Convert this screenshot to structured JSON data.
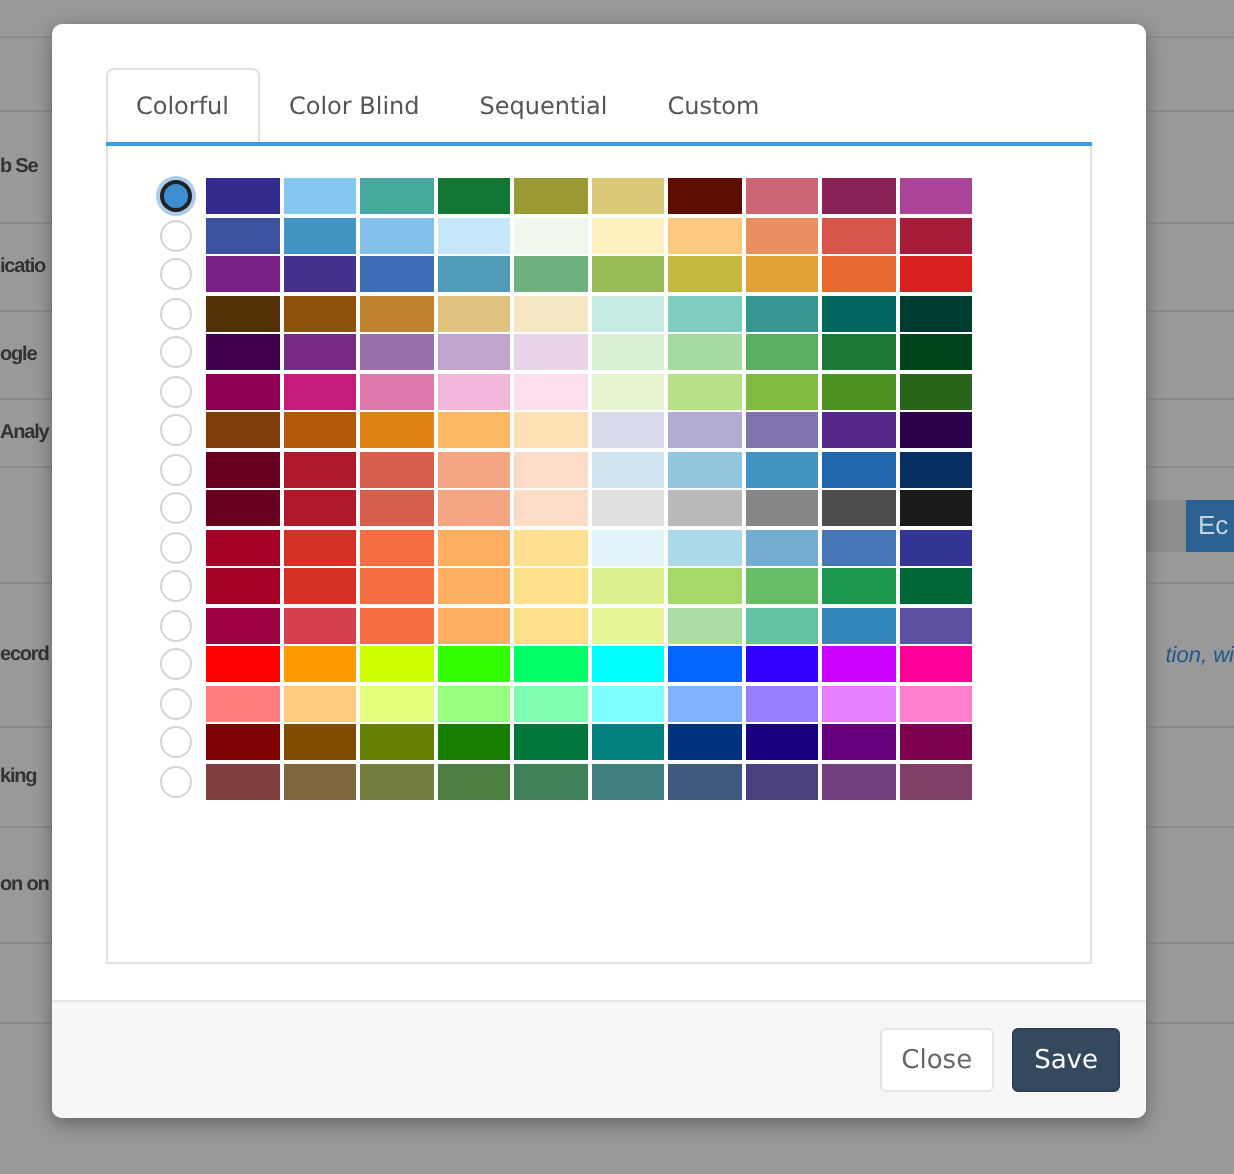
{
  "background_page": {
    "labels": [
      {
        "text": "b Se"
      },
      {
        "text": "icatio"
      },
      {
        "text": "ogle"
      },
      {
        "text": "Analy"
      },
      {
        "text": "ecord"
      },
      {
        "text": "king"
      },
      {
        "text": "on on"
      }
    ],
    "edit_button": "Ec",
    "note": "tion, wi"
  },
  "dialog": {
    "tabs": [
      {
        "label": "Colorful",
        "selected": true
      },
      {
        "label": "Color Blind",
        "selected": false
      },
      {
        "label": "Sequential",
        "selected": false
      },
      {
        "label": "Custom",
        "selected": false
      }
    ],
    "palettes": [
      {
        "selected": true,
        "swatches": [
          {
            "color": "#322a8c"
          },
          {
            "color": "#85c8ef"
          },
          {
            "color": "#45a99b"
          },
          {
            "color": "#127735"
          },
          {
            "color": "#9a9a35"
          },
          {
            "color": "#dbc97a"
          },
          {
            "color": "#5f0f00"
          },
          {
            "color": "#cc6677"
          },
          {
            "color": "#882255"
          },
          {
            "color": "#aa4499"
          }
        ]
      },
      {
        "selected": false,
        "swatches": [
          {
            "color": "#3e53a0"
          },
          {
            "color": "#4393c3"
          },
          {
            "color": "#86c1ec"
          },
          {
            "color": "#c8e6f9"
          },
          {
            "color": "#f0f7ed"
          },
          {
            "color": "#fdf0bd"
          },
          {
            "color": "#fdc980"
          },
          {
            "color": "#ea9060"
          },
          {
            "color": "#d6574a"
          },
          {
            "color": "#a61c3a"
          }
        ]
      },
      {
        "selected": false,
        "swatches": [
          {
            "color": "#7a1f86"
          },
          {
            "color": "#45318c"
          },
          {
            "color": "#3f6db5"
          },
          {
            "color": "#509bb7"
          },
          {
            "color": "#6fb27f"
          },
          {
            "color": "#9bbb59"
          },
          {
            "color": "#c5b840"
          },
          {
            "color": "#e1a236"
          },
          {
            "color": "#e86930"
          },
          {
            "color": "#da2121"
          }
        ]
      },
      {
        "selected": false,
        "swatches": [
          {
            "color": "#543005"
          },
          {
            "color": "#8c510a"
          },
          {
            "color": "#bf812d"
          },
          {
            "color": "#dfc27d"
          },
          {
            "color": "#f6e8c3"
          },
          {
            "color": "#c7eae5"
          },
          {
            "color": "#80cdc1"
          },
          {
            "color": "#35978f"
          },
          {
            "color": "#01665e"
          },
          {
            "color": "#003c30"
          }
        ]
      },
      {
        "selected": false,
        "swatches": [
          {
            "color": "#40004b"
          },
          {
            "color": "#762a83"
          },
          {
            "color": "#9970ab"
          },
          {
            "color": "#c2a5cf"
          },
          {
            "color": "#e7d4e8"
          },
          {
            "color": "#d9f0d3"
          },
          {
            "color": "#a6dba0"
          },
          {
            "color": "#5aae61"
          },
          {
            "color": "#1b7837"
          },
          {
            "color": "#00441b"
          }
        ]
      },
      {
        "selected": false,
        "swatches": [
          {
            "color": "#8e0152"
          },
          {
            "color": "#c51b7d"
          },
          {
            "color": "#de77ae"
          },
          {
            "color": "#f1b6da"
          },
          {
            "color": "#fde0ef"
          },
          {
            "color": "#e6f5d0"
          },
          {
            "color": "#b8e186"
          },
          {
            "color": "#7fbc41"
          },
          {
            "color": "#4d9221"
          },
          {
            "color": "#276419"
          }
        ]
      },
      {
        "selected": false,
        "swatches": [
          {
            "color": "#7f3b08"
          },
          {
            "color": "#b35806"
          },
          {
            "color": "#e08214"
          },
          {
            "color": "#fdb863"
          },
          {
            "color": "#fee0b6"
          },
          {
            "color": "#d8daeb"
          },
          {
            "color": "#b2abd2"
          },
          {
            "color": "#8073ac"
          },
          {
            "color": "#542788"
          },
          {
            "color": "#2d004b"
          }
        ]
      },
      {
        "selected": false,
        "swatches": [
          {
            "color": "#67001f"
          },
          {
            "color": "#b2182b"
          },
          {
            "color": "#d6604d"
          },
          {
            "color": "#f4a582"
          },
          {
            "color": "#fddbc7"
          },
          {
            "color": "#d1e5f0"
          },
          {
            "color": "#92c5de"
          },
          {
            "color": "#4393c3"
          },
          {
            "color": "#2166ac"
          },
          {
            "color": "#053061"
          }
        ]
      },
      {
        "selected": false,
        "swatches": [
          {
            "color": "#67001f"
          },
          {
            "color": "#b2182b"
          },
          {
            "color": "#d6604d"
          },
          {
            "color": "#f4a582"
          },
          {
            "color": "#fddbc7"
          },
          {
            "color": "#e0e0e0"
          },
          {
            "color": "#bababa"
          },
          {
            "color": "#878787"
          },
          {
            "color": "#4d4d4d"
          },
          {
            "color": "#1a1a1a"
          }
        ]
      },
      {
        "selected": false,
        "swatches": [
          {
            "color": "#a50026"
          },
          {
            "color": "#d73027"
          },
          {
            "color": "#f46d43"
          },
          {
            "color": "#fdae61"
          },
          {
            "color": "#fee090"
          },
          {
            "color": "#e0f3f8"
          },
          {
            "color": "#abd9e9"
          },
          {
            "color": "#74add1"
          },
          {
            "color": "#4575b4"
          },
          {
            "color": "#313695"
          }
        ]
      },
      {
        "selected": false,
        "swatches": [
          {
            "color": "#a50026"
          },
          {
            "color": "#d73027"
          },
          {
            "color": "#f46d43"
          },
          {
            "color": "#fdae61"
          },
          {
            "color": "#fee08b"
          },
          {
            "color": "#d9ef8b"
          },
          {
            "color": "#a6d96a"
          },
          {
            "color": "#66bd63"
          },
          {
            "color": "#1a9850"
          },
          {
            "color": "#006837"
          }
        ]
      },
      {
        "selected": false,
        "swatches": [
          {
            "color": "#9e0142"
          },
          {
            "color": "#d53e4f"
          },
          {
            "color": "#f46d43"
          },
          {
            "color": "#fdae61"
          },
          {
            "color": "#fee08b"
          },
          {
            "color": "#e6f598"
          },
          {
            "color": "#abdda4"
          },
          {
            "color": "#66c2a5"
          },
          {
            "color": "#3288bd"
          },
          {
            "color": "#5e4fa2"
          }
        ]
      },
      {
        "selected": false,
        "swatches": [
          {
            "color": "#ff0000"
          },
          {
            "color": "#ff9900"
          },
          {
            "color": "#ccff00"
          },
          {
            "color": "#33ff00"
          },
          {
            "color": "#00ff66"
          },
          {
            "color": "#00ffff"
          },
          {
            "color": "#0066ff"
          },
          {
            "color": "#3300ff"
          },
          {
            "color": "#cc00ff"
          },
          {
            "color": "#ff0099"
          }
        ]
      },
      {
        "selected": false,
        "swatches": [
          {
            "color": "#ff7f7f"
          },
          {
            "color": "#ffcc7f"
          },
          {
            "color": "#e5ff7f"
          },
          {
            "color": "#99ff7f"
          },
          {
            "color": "#7fffb2"
          },
          {
            "color": "#7fffff"
          },
          {
            "color": "#7fb2ff"
          },
          {
            "color": "#997fff"
          },
          {
            "color": "#e57fff"
          },
          {
            "color": "#ff7fcc"
          }
        ]
      },
      {
        "selected": false,
        "swatches": [
          {
            "color": "#7f0000"
          },
          {
            "color": "#7f4c00"
          },
          {
            "color": "#667f00"
          },
          {
            "color": "#197f00"
          },
          {
            "color": "#00773a"
          },
          {
            "color": "#007f7f"
          },
          {
            "color": "#00337f"
          },
          {
            "color": "#19007f"
          },
          {
            "color": "#66007f"
          },
          {
            "color": "#7f004c"
          }
        ]
      },
      {
        "selected": false,
        "swatches": [
          {
            "color": "#7f3f3f"
          },
          {
            "color": "#7f663f"
          },
          {
            "color": "#727f3f"
          },
          {
            "color": "#4c7f3f"
          },
          {
            "color": "#3f7f59"
          },
          {
            "color": "#3f7f7f"
          },
          {
            "color": "#3f597f"
          },
          {
            "color": "#4c3f7f"
          },
          {
            "color": "#723f7f"
          },
          {
            "color": "#7f3f66"
          }
        ]
      }
    ],
    "buttons": [
      {
        "label": "Close",
        "kind": "secondary"
      },
      {
        "label": "Save",
        "kind": "primary"
      }
    ]
  }
}
